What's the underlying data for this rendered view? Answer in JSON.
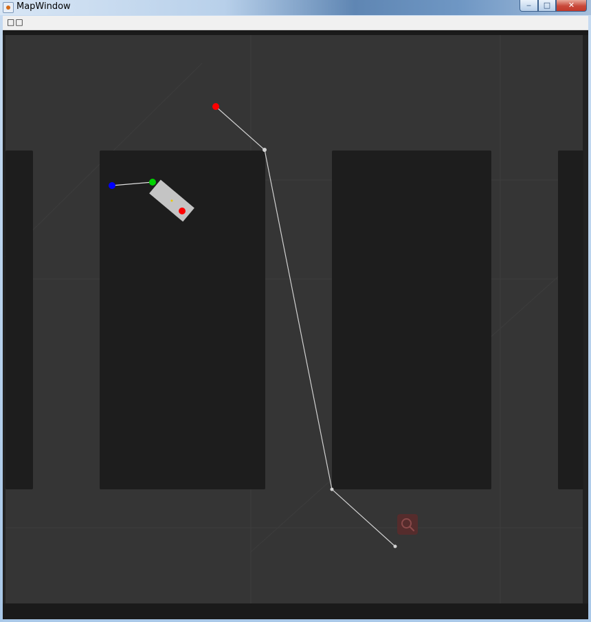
{
  "window": {
    "title": "MapWindow",
    "buttons": {
      "minimize": "‒",
      "maximize": "□",
      "close": "✕"
    }
  },
  "menu": {
    "item_label": "□□"
  },
  "map": {
    "colors": {
      "floor": "#353535",
      "shelf": "#1d1d1d",
      "border": "#1a1a1a",
      "path": "#d2d2d2",
      "robot_body": "#c4c4c4",
      "marker_red": "#ff0000",
      "marker_green": "#00d200",
      "marker_blue": "#0000ff",
      "search_badge": "#5a2a2a"
    },
    "icons": [
      "search-icon"
    ]
  }
}
